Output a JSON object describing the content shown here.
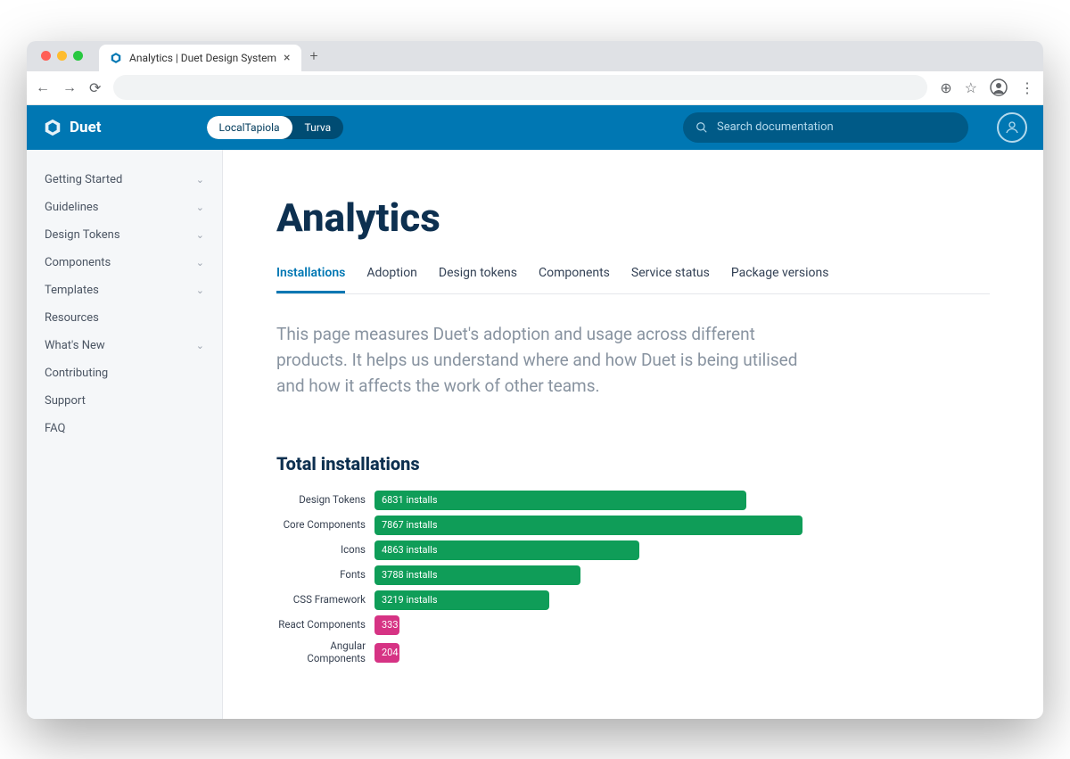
{
  "browser": {
    "tab_title": "Analytics | Duet Design System"
  },
  "header": {
    "logo_text": "Duet",
    "toggle": {
      "option_a": "LocalTapiola",
      "option_b": "Turva"
    },
    "search_placeholder": "Search documentation"
  },
  "sidebar": {
    "items": [
      {
        "label": "Getting Started",
        "expandable": true
      },
      {
        "label": "Guidelines",
        "expandable": true
      },
      {
        "label": "Design Tokens",
        "expandable": true
      },
      {
        "label": "Components",
        "expandable": true
      },
      {
        "label": "Templates",
        "expandable": true
      },
      {
        "label": "Resources",
        "expandable": false
      },
      {
        "label": "What's New",
        "expandable": true
      },
      {
        "label": "Contributing",
        "expandable": false
      },
      {
        "label": "Support",
        "expandable": false
      },
      {
        "label": "FAQ",
        "expandable": false
      }
    ]
  },
  "page": {
    "title": "Analytics",
    "tabs": [
      "Installations",
      "Adoption",
      "Design tokens",
      "Components",
      "Service status",
      "Package versions"
    ],
    "active_tab": 0,
    "intro": "This page measures Duet's adoption and usage across different products. It helps us understand where and how Duet is being utilised and how it affects the work of other teams.",
    "chart_title": "Total installations"
  },
  "chart_data": {
    "type": "bar",
    "title": "Total installations",
    "xlabel": "",
    "ylabel": "",
    "unit": "installs",
    "max": 7867,
    "series": [
      {
        "name": "Design Tokens",
        "value": 6831,
        "label": "6831 installs",
        "color": "green"
      },
      {
        "name": "Core Components",
        "value": 7867,
        "label": "7867 installs",
        "color": "green"
      },
      {
        "name": "Icons",
        "value": 4863,
        "label": "4863 installs",
        "color": "green"
      },
      {
        "name": "Fonts",
        "value": 3788,
        "label": "3788 installs",
        "color": "green"
      },
      {
        "name": "CSS Framework",
        "value": 3219,
        "label": "3219 installs",
        "color": "green"
      },
      {
        "name": "React Components",
        "value": 333,
        "label": "333",
        "color": "pink"
      },
      {
        "name": "Angular Components",
        "value": 204,
        "label": "204",
        "color": "pink"
      }
    ]
  }
}
